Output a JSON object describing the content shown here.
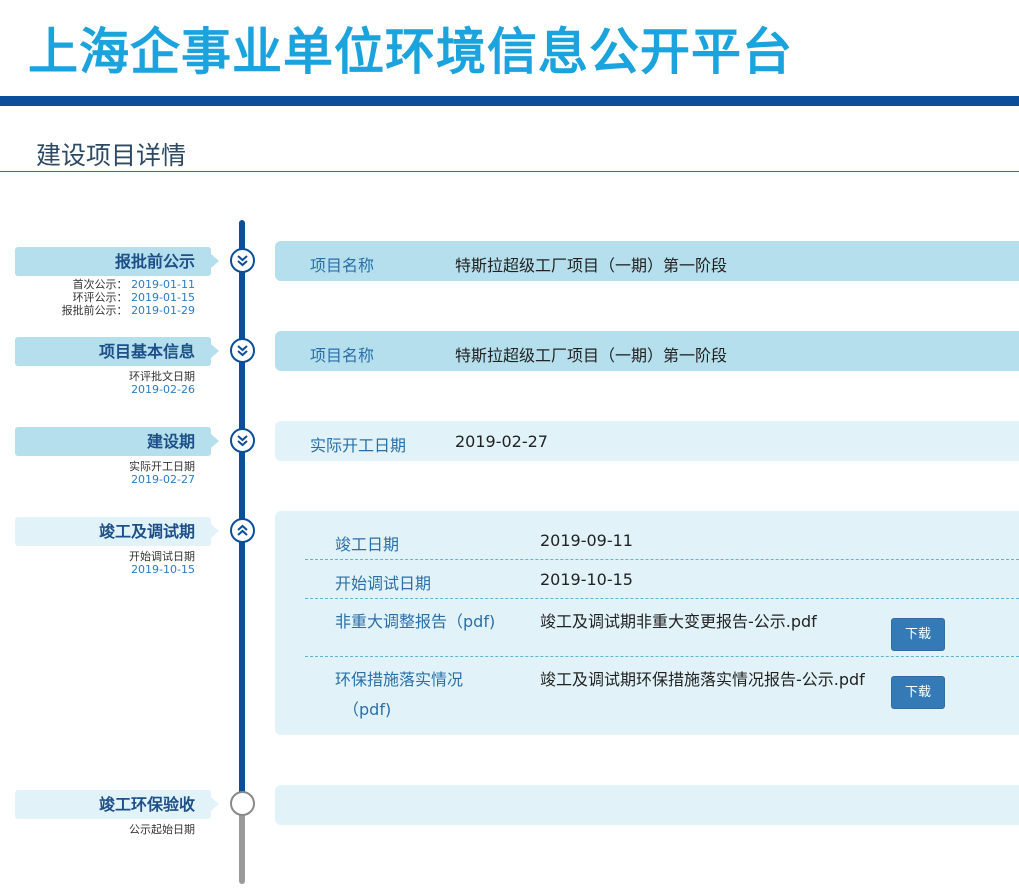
{
  "site": {
    "title": "上海企事业单位环境信息公开平台"
  },
  "page": {
    "title": "建设项目详情"
  },
  "colors": {
    "brand": "#1aa3dc",
    "bar": "#0b4f9a",
    "panel_dark": "#b5dfec",
    "panel_light": "#e1f3f9",
    "button": "#337ab7"
  },
  "stages": {
    "pre_approval": {
      "label": "报批前公示",
      "icon": "double-chevron-down-icon",
      "dates": [
        {
          "key": "首次公示：",
          "value": "2019-01-11"
        },
        {
          "key": "环评公示：",
          "value": "2019-01-15"
        },
        {
          "key": "报批前公示：",
          "value": "2019-01-29"
        }
      ],
      "panel": {
        "key": "项目名称",
        "value": "特斯拉超级工厂项目（一期）第一阶段"
      }
    },
    "basic_info": {
      "label": "项目基本信息",
      "icon": "double-chevron-down-icon",
      "sub_key": "环评批文日期",
      "sub_value": "2019-02-26",
      "panel": {
        "key": "项目名称",
        "value": "特斯拉超级工厂项目（一期）第一阶段"
      }
    },
    "construction": {
      "label": "建设期",
      "icon": "double-chevron-down-icon",
      "sub_key": "实际开工日期",
      "sub_value": "2019-02-27",
      "panel": {
        "key": "实际开工日期",
        "value": "2019-02-27"
      }
    },
    "completion": {
      "label": "竣工及调试期",
      "icon": "double-chevron-up-icon",
      "sub_key": "开始调试日期",
      "sub_value": "2019-10-15",
      "rows": [
        {
          "key": "竣工日期",
          "value": "2019-09-11"
        },
        {
          "key": "开始调试日期",
          "value": "2019-10-15"
        },
        {
          "key": "非重大调整报告（pdf)",
          "value": "竣工及调试期非重大变更报告-公示.pdf",
          "button": "下载"
        },
        {
          "key": "环保措施落实情况",
          "key2": "（pdf)",
          "value": "竣工及调试期环保措施落实情况报告-公示.pdf",
          "button": "下载"
        }
      ]
    },
    "acceptance": {
      "label": "竣工环保验收",
      "icon": "empty-circle-icon",
      "sub_key": "公示起始日期"
    }
  }
}
